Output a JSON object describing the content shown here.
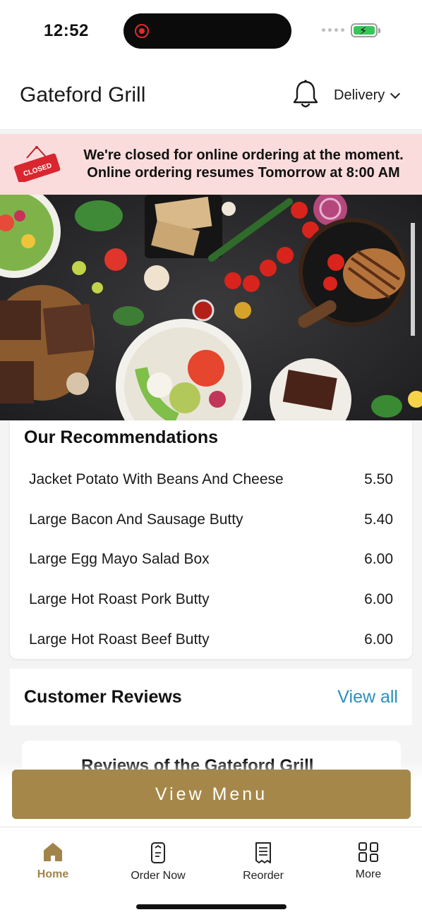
{
  "status_bar": {
    "time": "12:52",
    "recording_icon": "screen-record-icon",
    "battery_icon": "battery-charging-icon",
    "battery_color": "#35c759"
  },
  "header": {
    "title": "Gateford Grill",
    "bell_icon": "bell-icon",
    "order_mode": "Delivery"
  },
  "closed_banner": {
    "sign_text": "CLOSED",
    "line1": "We're closed for online ordering at the moment.",
    "line2": "Online ordering resumes Tomorrow at 8:00 AM",
    "background": "#fadcdc"
  },
  "recommendations": {
    "title": "Our Recommendations",
    "items": [
      {
        "name": "Jacket Potato With Beans And Cheese",
        "price": "5.50"
      },
      {
        "name": "Large Bacon And Sausage Butty",
        "price": "5.40"
      },
      {
        "name": "Large Egg Mayo Salad Box",
        "price": "6.00"
      },
      {
        "name": "Large Hot Roast Pork Butty",
        "price": "6.00"
      },
      {
        "name": "Large Hot Roast Beef Butty",
        "price": "6.00"
      }
    ]
  },
  "reviews": {
    "title": "Customer Reviews",
    "view_all": "View all",
    "preview_text": "Reviews of the Gateford Grill",
    "link_color": "#2a8fbd"
  },
  "view_menu_label": "View Menu",
  "accent_color": "#a58849",
  "bottom_nav": {
    "items": [
      {
        "label": "Home",
        "icon": "home-icon",
        "active": true
      },
      {
        "label": "Order Now",
        "icon": "phone-order-icon",
        "active": false
      },
      {
        "label": "Reorder",
        "icon": "receipt-icon",
        "active": false
      },
      {
        "label": "More",
        "icon": "grid-icon",
        "active": false
      }
    ]
  }
}
